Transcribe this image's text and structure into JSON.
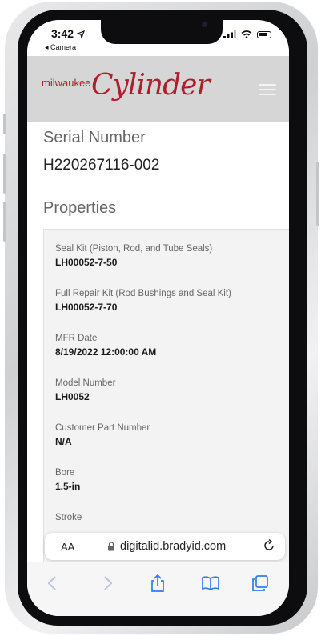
{
  "status": {
    "time": "3:42",
    "back_label": "◂ Camera"
  },
  "brand": {
    "prefix": "milwaukee",
    "name": "Cylinder"
  },
  "serial": {
    "label": "Serial Number",
    "value": "H220267116-002"
  },
  "properties": {
    "heading": "Properties",
    "items": [
      {
        "label": "Seal Kit (Piston, Rod, and Tube Seals)",
        "value": "LH00052-7-50"
      },
      {
        "label": "Full Repair Kit (Rod Bushings and Seal Kit)",
        "value": "LH00052-7-70"
      },
      {
        "label": "MFR Date",
        "value": "8/19/2022 12:00:00 AM"
      },
      {
        "label": "Model Number",
        "value": "LH0052"
      },
      {
        "label": "Customer Part Number",
        "value": "N/A"
      },
      {
        "label": "Bore",
        "value": "1.5-in"
      },
      {
        "label": "Stroke",
        "value": ""
      }
    ]
  },
  "browser": {
    "text_size_label": "AA",
    "url": "digitalid.bradyid.com"
  },
  "colors": {
    "brand_red": "#b01e2c",
    "header_bg": "#d6d6d6",
    "ios_blue": "#2f7cf6"
  },
  "icons": [
    "location-arrow-icon",
    "signal-icon",
    "wifi-icon",
    "battery-icon",
    "menu-icon",
    "lock-icon",
    "reload-icon",
    "back-icon",
    "forward-icon",
    "share-icon",
    "bookmarks-icon",
    "tabs-icon"
  ]
}
